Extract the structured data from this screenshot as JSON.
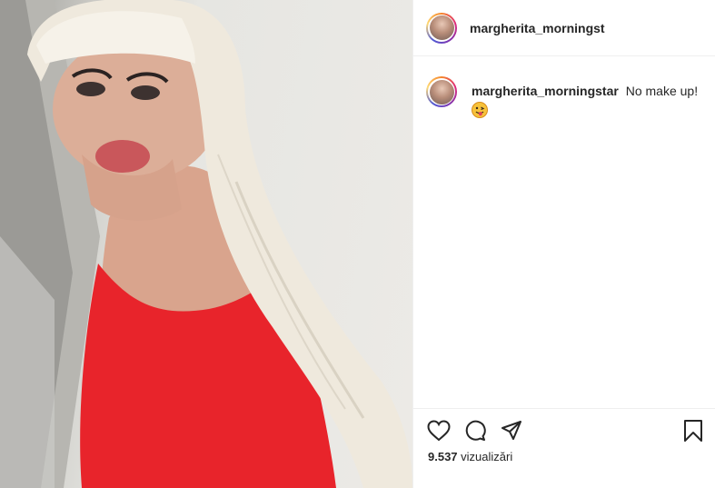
{
  "post": {
    "username": "margherita_morningstar",
    "header_username_visible": "margherita_morningst",
    "caption_text": "No make up!",
    "caption_emoji": "😛",
    "views_count": "9.537",
    "views_label": "vizualizări"
  },
  "icons": {
    "like": "heart-icon",
    "comment": "comment-icon",
    "share": "share-icon",
    "save": "bookmark-icon"
  },
  "colors": {
    "dress": "#e8242b",
    "hair": "#f1ece1",
    "text": "#262626",
    "border": "#efefef"
  }
}
